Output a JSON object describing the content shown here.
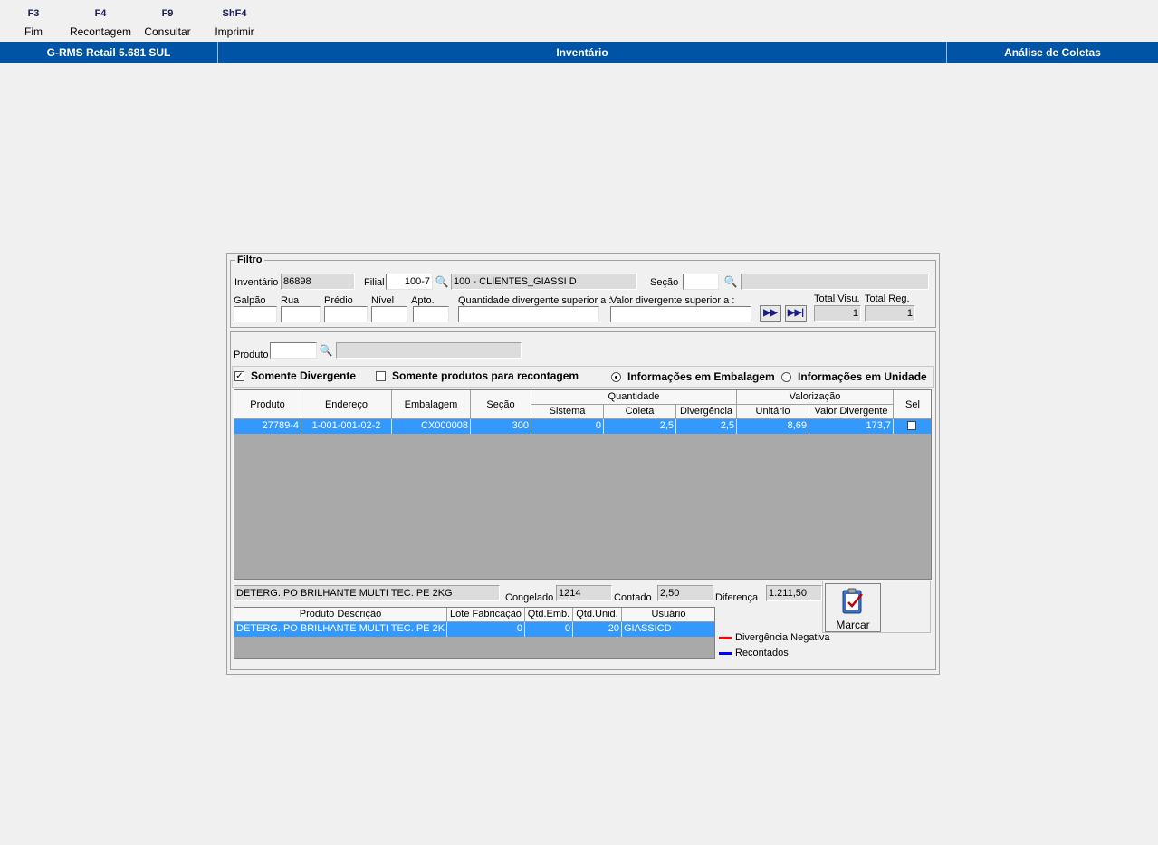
{
  "toolbar": {
    "keys": [
      {
        "key": "F3",
        "label": "Fim"
      },
      {
        "key": "F4",
        "label": "Recontagem"
      },
      {
        "key": "F9",
        "label": "Consultar"
      },
      {
        "key": "ShF4",
        "label": "Imprimir"
      }
    ]
  },
  "titlebar": {
    "app": "G-RMS Retail 5.681 SUL",
    "module": "Inventário",
    "screen": "Análise de Coletas",
    "color": "#0054a6"
  },
  "filtro": {
    "title": "Filtro",
    "inventario_label": "Inventário",
    "inventario_value": "86898",
    "filial_label": "Filial",
    "filial_value": "100-7",
    "filial_desc": "100 - CLIENTES_GIASSI D",
    "secao_label": "Seção",
    "secao_value": "",
    "secao_desc": "",
    "galpao_label": "Galpão",
    "rua_label": "Rua",
    "predio_label": "Prédio",
    "nivel_label": "Nível",
    "apto_label": "Apto.",
    "qtd_div_label": "Quantidade divergente superior a :",
    "valor_div_label": "Valor divergente superior a :",
    "total_visu_label": "Total Visu.",
    "total_visu_value": "1",
    "total_reg_label": "Total Reg.",
    "total_reg_value": "1"
  },
  "produto": {
    "label": "Produto",
    "value": "",
    "desc": ""
  },
  "options": {
    "somente_divergente": {
      "label": "Somente Divergente",
      "checked": true
    },
    "somente_recontagem": {
      "label": "Somente produtos para recontagem",
      "checked": false
    },
    "info_embalagem": {
      "label": "Informações em Embalagem",
      "selected": true
    },
    "info_unidade": {
      "label": "Informações em Unidade",
      "selected": false
    }
  },
  "main_grid": {
    "headers": {
      "produto": "Produto",
      "endereco": "Endereço",
      "embalagem": "Embalagem",
      "secao": "Seção",
      "quantidade": "Quantidade",
      "sistema": "Sistema",
      "coleta": "Coleta",
      "divergencia": "Divergência",
      "valorizacao": "Valorização",
      "unitario": "Unitário",
      "valor_divergente": "Valor Divergente",
      "sel": "Sel"
    },
    "rows": [
      {
        "produto": "27789-4",
        "endereco": "1-001-001-02-2",
        "embalagem": "CX000008",
        "secao": "300",
        "sistema": "0",
        "coleta": "2,5",
        "divergencia": "2,5",
        "unitario": "8,69",
        "valor_divergente": "173,7",
        "sel": false
      }
    ]
  },
  "detail": {
    "descricao": "DETERG. PO BRILHANTE MULTI TEC. PE   2KG",
    "congelado_label": "Congelado",
    "congelado_value": "1214",
    "contado_label": "Contado",
    "contado_value": "2,50",
    "diferenca_label": "Diferença",
    "diferenca_value": "1.211,50"
  },
  "marcar_button": {
    "label": "Marcar",
    "icon": "clipboard-check-icon"
  },
  "sub_grid": {
    "headers": {
      "descricao": "Produto Descrição",
      "lote": "Lote Fabricação",
      "qtd_emb": "Qtd.Emb.",
      "qtd_unid": "Qtd.Unid.",
      "usuario": "Usuário"
    },
    "rows": [
      {
        "descricao": "DETERG. PO BRILHANTE MULTI TEC. PE   2K",
        "lote": "0",
        "qtd_emb": "0",
        "qtd_unid": "20",
        "usuario": "GIASSICD"
      }
    ]
  },
  "legend": {
    "negativa": {
      "label": "Divergência Negativa",
      "color": "#ff0000"
    },
    "recontados": {
      "label": "Recontados",
      "color": "#0000ff"
    }
  },
  "colors": {
    "selection": "#3399ff",
    "grid_empty": "#a9a9a9"
  }
}
